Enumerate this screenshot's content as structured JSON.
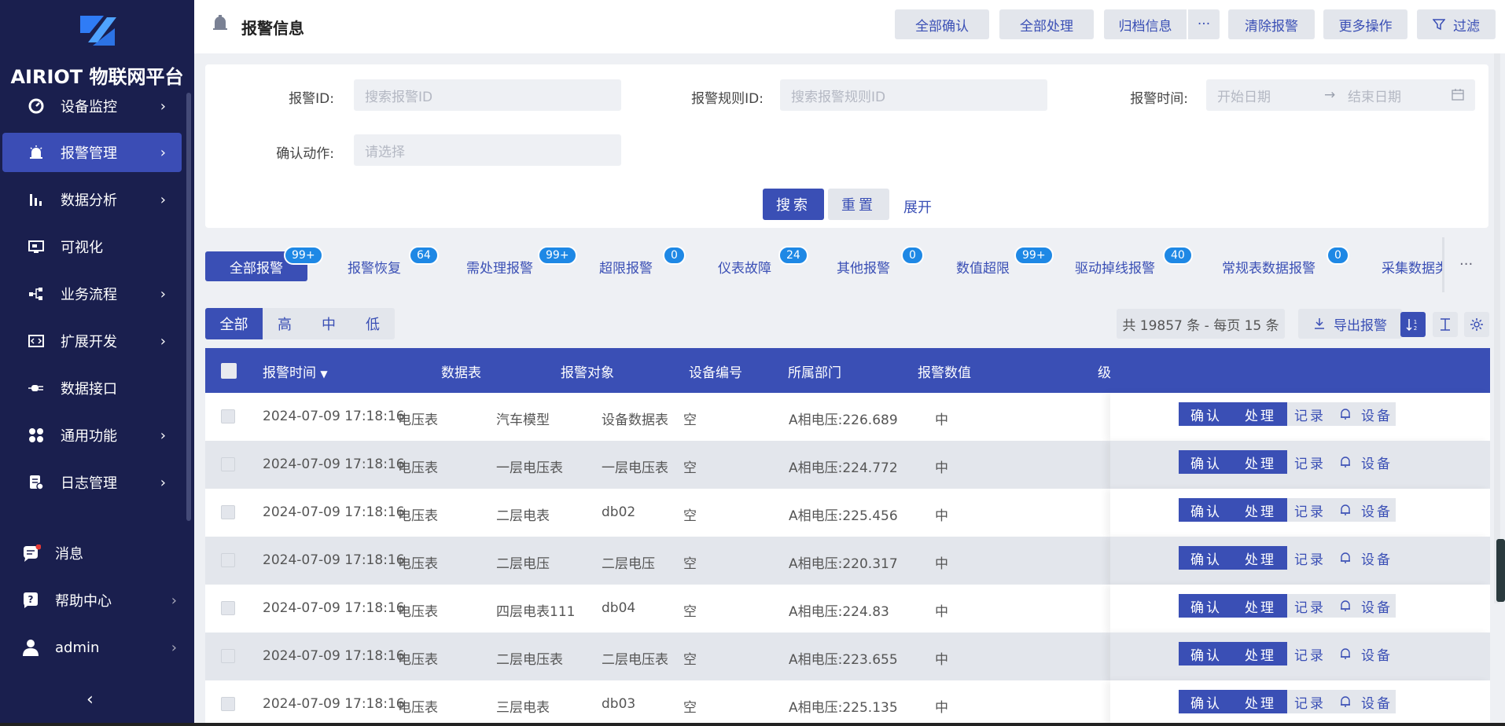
{
  "app": {
    "logo_text": "AIRIOT 物联网平台"
  },
  "sidebar": {
    "items": [
      {
        "label": "设备监控",
        "icon": "gauge-icon",
        "arrow": "›"
      },
      {
        "label": "报警管理",
        "icon": "alarm-icon",
        "arrow": "›",
        "active": true
      },
      {
        "label": "数据分析",
        "icon": "bar-chart-icon",
        "arrow": "›"
      },
      {
        "label": "可视化",
        "icon": "monitor-icon",
        "arrow": ""
      },
      {
        "label": "业务流程",
        "icon": "flow-icon",
        "arrow": "›"
      },
      {
        "label": "扩展开发",
        "icon": "code-icon",
        "arrow": "›"
      },
      {
        "label": "数据接口",
        "icon": "plug-icon",
        "arrow": ""
      },
      {
        "label": "通用功能",
        "icon": "grid-icon",
        "arrow": "›"
      },
      {
        "label": "日志管理",
        "icon": "log-icon",
        "arrow": "›"
      }
    ],
    "bottom": [
      {
        "label": "消息",
        "icon": "message-icon",
        "arrow": ""
      },
      {
        "label": "帮助中心",
        "icon": "help-icon",
        "arrow": "›"
      },
      {
        "label": "admin",
        "icon": "user-icon",
        "arrow": "›"
      }
    ],
    "collapse": "‹"
  },
  "header": {
    "title": "报警信息",
    "buttons": {
      "confirm_all": "全部确认",
      "handle_all": "全部处理",
      "archive": "归档信息",
      "more_dots": "···",
      "clear": "清除报警",
      "more_ops": "更多操作",
      "filter": "过滤"
    }
  },
  "search": {
    "alarm_id_label": "报警ID:",
    "alarm_id_placeholder": "搜索报警ID",
    "rule_id_label": "报警规则ID:",
    "rule_id_placeholder": "搜索报警规则ID",
    "time_label": "报警时间:",
    "start_placeholder": "开始日期",
    "arrow": "→",
    "end_placeholder": "结束日期",
    "confirm_action_label": "确认动作:",
    "confirm_action_placeholder": "请选择",
    "search_btn": "搜索",
    "reset_btn": "重置",
    "expand_btn": "展开"
  },
  "tabs": [
    {
      "label": "全部报警",
      "badge": "99+"
    },
    {
      "label": "报警恢复",
      "badge": "64"
    },
    {
      "label": "需处理报警",
      "badge": "99+"
    },
    {
      "label": "超限报警",
      "badge": "0"
    },
    {
      "label": "仪表故障",
      "badge": "24"
    },
    {
      "label": "其他报警",
      "badge": "0"
    },
    {
      "label": "数值超限",
      "badge": "99+"
    },
    {
      "label": "驱动掉线报警",
      "badge": "40"
    },
    {
      "label": "常规表数据报警",
      "badge": "0"
    },
    {
      "label": "采集数据类",
      "badge": ""
    }
  ],
  "tabs_more": "···",
  "levels": [
    "全部",
    "高",
    "中",
    "低"
  ],
  "toolbar": {
    "count": "共 19857 条 - 每页 15 条",
    "export": "导出报警"
  },
  "table": {
    "headers": [
      "报警时间",
      "数据表",
      "报警对象",
      "设备编号",
      "所属部门",
      "报警数值",
      "级"
    ],
    "sort_indicator": "▼",
    "actions": [
      "确认",
      "处理",
      "记录",
      "设备"
    ],
    "rows": [
      [
        "2024-07-09 17:18:16",
        "电压表",
        "汽车模型",
        "设备数据表",
        "空",
        "A相电压:226.689",
        "中"
      ],
      [
        "2024-07-09 17:18:16",
        "电压表",
        "一层电压表",
        "一层电压表",
        "空",
        "A相电压:224.772",
        "中"
      ],
      [
        "2024-07-09 17:18:16",
        "电压表",
        "二层电表",
        "db02",
        "空",
        "A相电压:225.456",
        "中"
      ],
      [
        "2024-07-09 17:18:16",
        "电压表",
        "二层电压",
        "二层电压",
        "空",
        "A相电压:220.317",
        "中"
      ],
      [
        "2024-07-09 17:18:16",
        "电压表",
        "四层电表111",
        "db04",
        "空",
        "A相电压:224.83",
        "中"
      ],
      [
        "2024-07-09 17:18:16",
        "电压表",
        "二层电压表",
        "二层电压表",
        "空",
        "A相电压:223.655",
        "中"
      ],
      [
        "2024-07-09 17:18:16",
        "电压表",
        "三层电表",
        "db03",
        "空",
        "A相电压:225.135",
        "中"
      ]
    ]
  },
  "colors": {
    "sidebar_bg": "#1a1f4e",
    "accent": "#3a4fb5",
    "badge": "#1e88e5",
    "notification_dot": "#e53935"
  }
}
